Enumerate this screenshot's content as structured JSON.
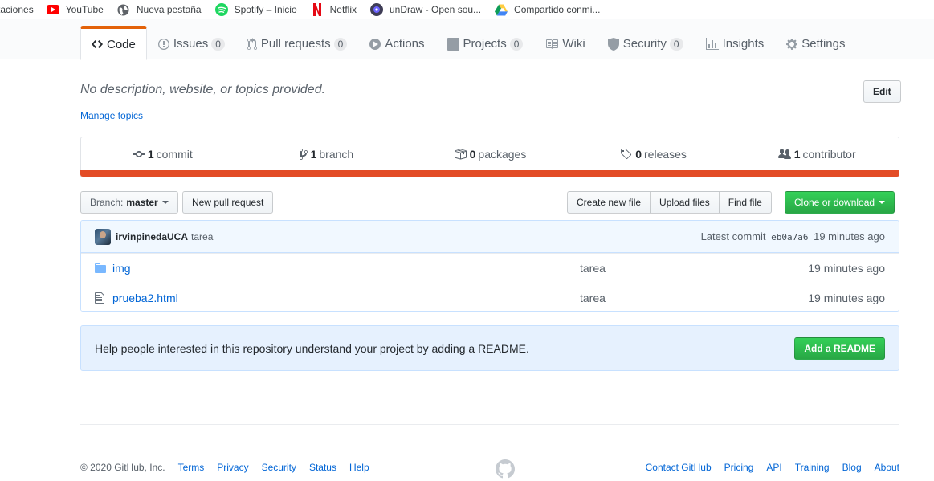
{
  "bookmarks": [
    {
      "label": "taciones",
      "icon": "none"
    },
    {
      "label": "YouTube",
      "icon": "youtube-icon"
    },
    {
      "label": "Nueva pestaña",
      "icon": "globe-icon"
    },
    {
      "label": "Spotify – Inicio",
      "icon": "spotify-icon"
    },
    {
      "label": "Netflix",
      "icon": "netflix-icon"
    },
    {
      "label": "unDraw - Open sou...",
      "icon": "undraw-icon"
    },
    {
      "label": "Compartido conmi...",
      "icon": "drive-icon"
    }
  ],
  "tabs": [
    {
      "label": "Code",
      "icon": "code-icon",
      "selected": true
    },
    {
      "label": "Issues",
      "icon": "issue-icon",
      "count": "0"
    },
    {
      "label": "Pull requests",
      "icon": "pull-request-icon",
      "count": "0"
    },
    {
      "label": "Actions",
      "icon": "play-icon"
    },
    {
      "label": "Projects",
      "icon": "project-icon",
      "count": "0"
    },
    {
      "label": "Wiki",
      "icon": "book-icon"
    },
    {
      "label": "Security",
      "icon": "shield-icon",
      "count": "0"
    },
    {
      "label": "Insights",
      "icon": "graph-icon"
    },
    {
      "label": "Settings",
      "icon": "gear-icon"
    }
  ],
  "repo": {
    "description": "No description, website, or topics provided.",
    "manage_topics": "Manage topics",
    "edit_label": "Edit"
  },
  "summary": {
    "commits": {
      "count": "1",
      "label": "commit"
    },
    "branches": {
      "count": "1",
      "label": "branch"
    },
    "packages": {
      "count": "0",
      "label": "packages"
    },
    "releases": {
      "count": "0",
      "label": "releases"
    },
    "contributors": {
      "count": "1",
      "label": "contributor"
    }
  },
  "language_color": "#e34c26",
  "filenav": {
    "branch_prefix": "Branch:",
    "branch_name": "master",
    "new_pr": "New pull request",
    "create_file": "Create new file",
    "upload_files": "Upload files",
    "find_file": "Find file",
    "clone": "Clone or download"
  },
  "commit": {
    "author": "irvinpinedaUCA",
    "message": "tarea",
    "latest_label": "Latest commit",
    "sha": "eb0a7a6",
    "age": "19 minutes ago"
  },
  "files": [
    {
      "name": "img",
      "type": "directory",
      "message": "tarea",
      "age": "19 minutes ago"
    },
    {
      "name": "prueba2.html",
      "type": "file",
      "message": "tarea",
      "age": "19 minutes ago"
    }
  ],
  "readme_prompt": {
    "text": "Help people interested in this repository understand your project by adding a README.",
    "button": "Add a README"
  },
  "footer": {
    "copyright": "© 2020 GitHub, Inc.",
    "left_links": [
      "Terms",
      "Privacy",
      "Security",
      "Status",
      "Help"
    ],
    "right_links": [
      "Contact GitHub",
      "Pricing",
      "API",
      "Training",
      "Blog",
      "About"
    ]
  }
}
